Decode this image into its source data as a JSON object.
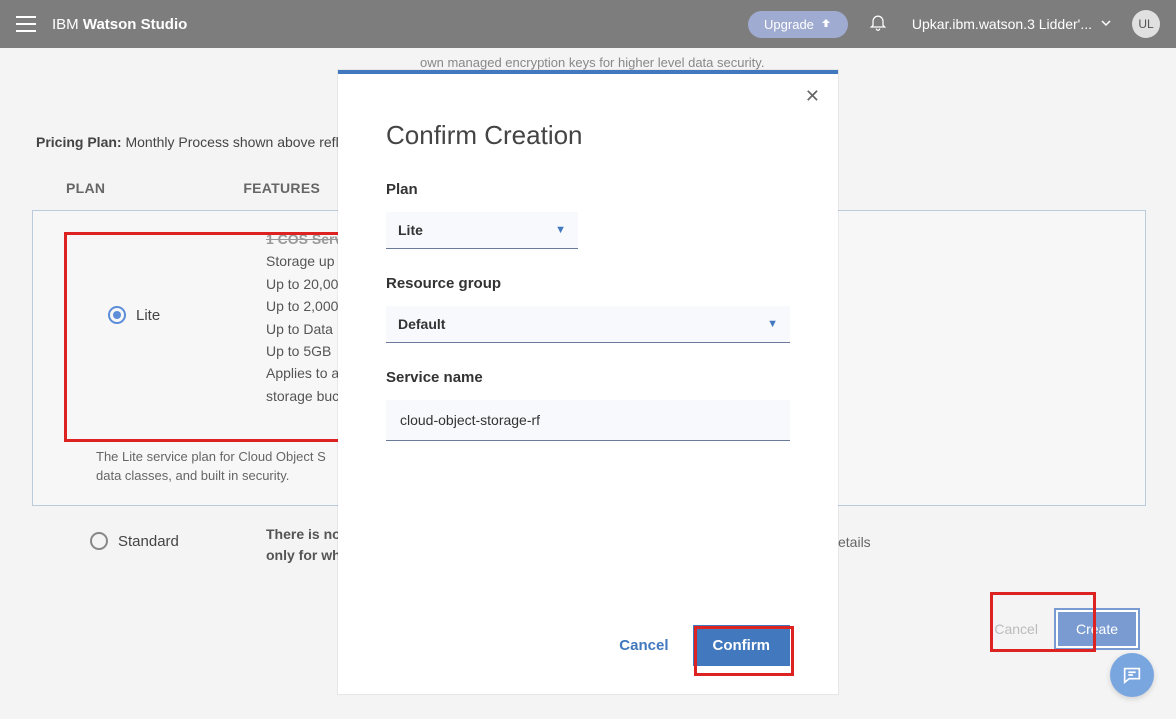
{
  "header": {
    "brand_prefix": "IBM",
    "brand_main": "Watson Studio",
    "upgrade": "Upgrade",
    "user_label": "Upkar.ibm.watson.3 Lidder'...",
    "avatar_initials": "UL"
  },
  "background": {
    "crypto_text": "own managed encryption keys for higher level data security.",
    "pricing_label": "Pricing Plan:",
    "pricing_text": "Monthly Process shown above refle",
    "col_plan": "PLAN",
    "col_features": "FEATURES",
    "radio_lite": "Lite",
    "radio_standard": "Standard",
    "features": {
      "l0": "1 COS Serv",
      "l1": "Storage up",
      "l2": "Up to 20,00",
      "l3": "Up to 2,000",
      "l4": "Up to Data",
      "l5": "Up to 5GB",
      "l6": "Applies to a",
      "l7": "storage buc"
    },
    "lite_desc1": "The Lite service plan for Cloud Object S",
    "lite_desc2": "data classes, and built in security.",
    "std_desc1": "There is no",
    "std_desc2": "only for wh",
    "details": "etails",
    "cancel": "Cancel",
    "create": "Create"
  },
  "modal": {
    "title": "Confirm Creation",
    "plan_label": "Plan",
    "plan_value": "Lite",
    "rg_label": "Resource group",
    "rg_value": "Default",
    "service_label": "Service name",
    "service_value": "cloud-object-storage-rf",
    "cancel": "Cancel",
    "confirm": "Confirm"
  }
}
